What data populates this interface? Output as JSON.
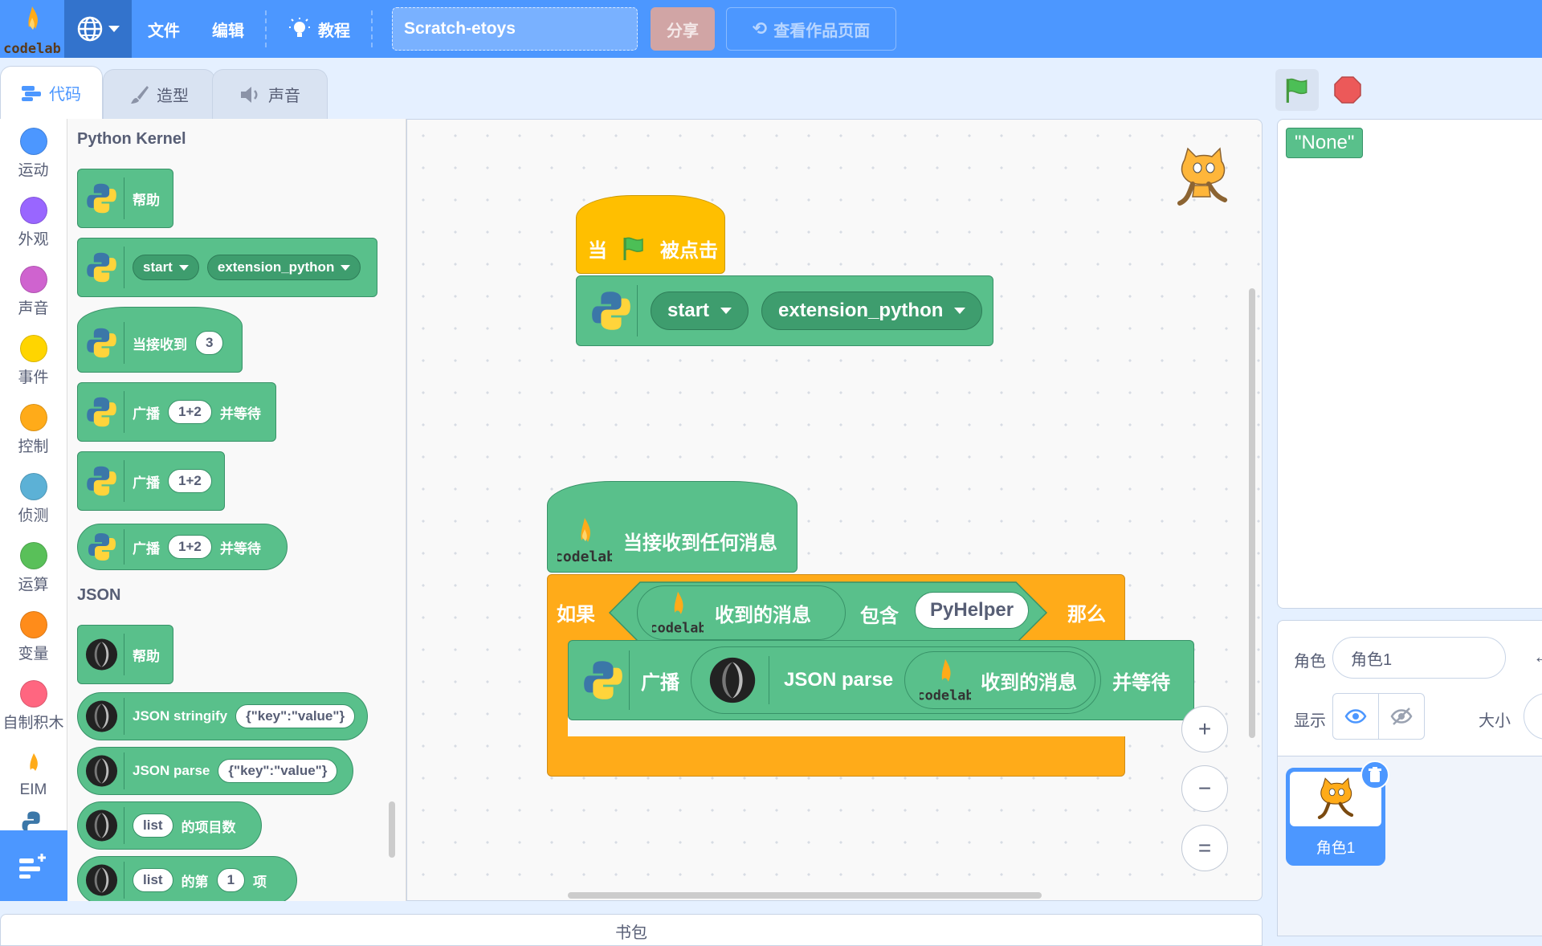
{
  "menu": {
    "logo_text": "codelab",
    "file": "文件",
    "edit": "编辑",
    "tutorial": "教程",
    "project_title": "Scratch-etoys",
    "share": "分享",
    "see_project": "查看作品页面"
  },
  "tabs": {
    "code": "代码",
    "costumes": "造型",
    "sounds": "声音"
  },
  "categories": [
    {
      "label": "运动",
      "color": "#4c97ff"
    },
    {
      "label": "外观",
      "color": "#9966ff"
    },
    {
      "label": "声音",
      "color": "#cf63cf"
    },
    {
      "label": "事件",
      "color": "#ffd500"
    },
    {
      "label": "控制",
      "color": "#ffab19"
    },
    {
      "label": "侦测",
      "color": "#5cb1d6"
    },
    {
      "label": "运算",
      "color": "#59c059"
    },
    {
      "label": "变量",
      "color": "#ff8c1a"
    },
    {
      "label": "自制积木",
      "color": "#ff6680"
    },
    {
      "label": "EIM",
      "color": "#ffffff"
    }
  ],
  "palette": {
    "python_title": "Python Kernel",
    "help": "帮助",
    "start": "start",
    "extension_python": "extension_python",
    "when_receive": "当接收到",
    "receive_value": "3",
    "broadcast": "广播",
    "broadcast_value": "1+2",
    "and_wait": "并等待",
    "json_title": "JSON",
    "json_help": "帮助",
    "json_stringify": "JSON stringify",
    "json_stringify_value": "{\"key\":\"value\"}",
    "json_parse": "JSON parse",
    "json_parse_value": "{\"key\":\"value\"}",
    "list": "list",
    "item_count": "的项目数",
    "the_nth": "的第",
    "nth_value": "1",
    "item": "项"
  },
  "workspace": {
    "when": "当",
    "clicked": "被点击",
    "start": "start",
    "extension_python": "extension_python",
    "when_receive_any": "当接收到任何消息",
    "if": "如果",
    "received_msg": "收到的消息",
    "contains": "包含",
    "pyhelper": "PyHelper",
    "question": "?",
    "then": "那么",
    "broadcast": "广播",
    "json_parse": "JSON parse",
    "received_msg2": "收到的消息",
    "and_wait": "并等待",
    "zoom_in": "+",
    "zoom_out": "−",
    "zoom_reset": "="
  },
  "stage": {
    "monitor": "\"None\""
  },
  "sprite_info": {
    "sprite_label": "角色",
    "sprite_name": "角色1",
    "show_label": "显示",
    "size_label": "大小"
  },
  "sprite_list": [
    {
      "name": "角色1"
    }
  ],
  "backpack": "书包",
  "colors": {
    "menu": "#4c97ff",
    "python_block": "#59c08b",
    "control": "#ffab19",
    "events": "#ffbf00"
  }
}
